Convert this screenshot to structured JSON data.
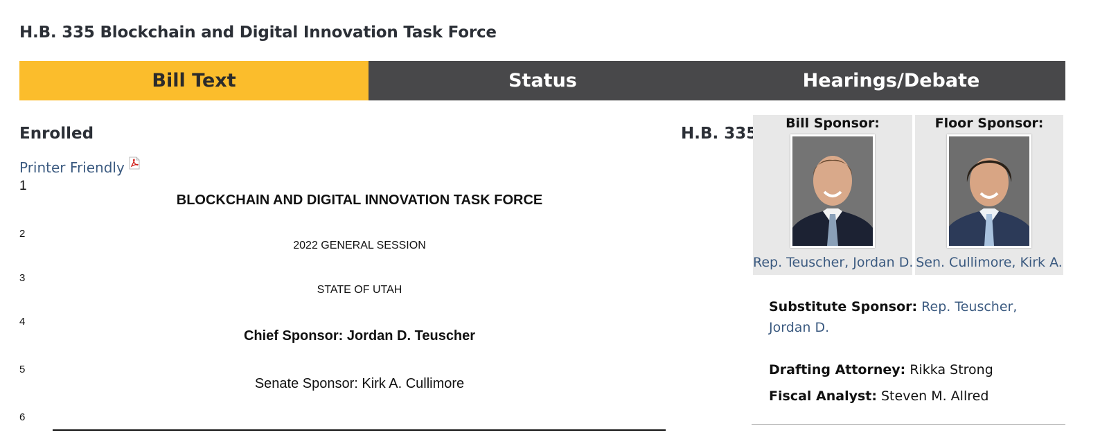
{
  "page": {
    "title": "H.B. 335 Blockchain and Digital Innovation Task Force"
  },
  "tabs": [
    {
      "label": "Bill Text",
      "active": true
    },
    {
      "label": "Status",
      "active": false
    },
    {
      "label": "Hearings/Debate",
      "active": false
    }
  ],
  "bill": {
    "version": "Enrolled",
    "printer_friendly": "Printer Friendly",
    "line_numbers": [
      "1",
      "2",
      "3",
      "4",
      "5",
      "6"
    ],
    "lines": [
      "BLOCKCHAIN AND DIGITAL INNOVATION TASK FORCE",
      "2022 GENERAL SESSION",
      "STATE OF UTAH",
      "Chief Sponsor: Jordan D. Teuscher",
      "Senate Sponsor: Kirk A. Cullimore"
    ]
  },
  "sidebar": {
    "bill_number": "H.B. 335",
    "bill_sponsor": {
      "heading": "Bill Sponsor:",
      "name": "Rep. Teuscher, Jordan D."
    },
    "floor_sponsor": {
      "heading": "Floor Sponsor:",
      "name": "Sen. Cullimore, Kirk A."
    },
    "substitute_sponsor": {
      "label": "Substitute Sponsor:",
      "value": "Rep. Teuscher, Jordan D."
    },
    "drafting_attorney": {
      "label": "Drafting Attorney:",
      "value": "Rikka Strong"
    },
    "fiscal_analyst": {
      "label": "Fiscal Analyst:",
      "value": "Steven M. Allred"
    }
  },
  "colors": {
    "active_tab": "#fbbd2c",
    "inactive_tab": "#48484a",
    "link": "#3b5a80"
  }
}
